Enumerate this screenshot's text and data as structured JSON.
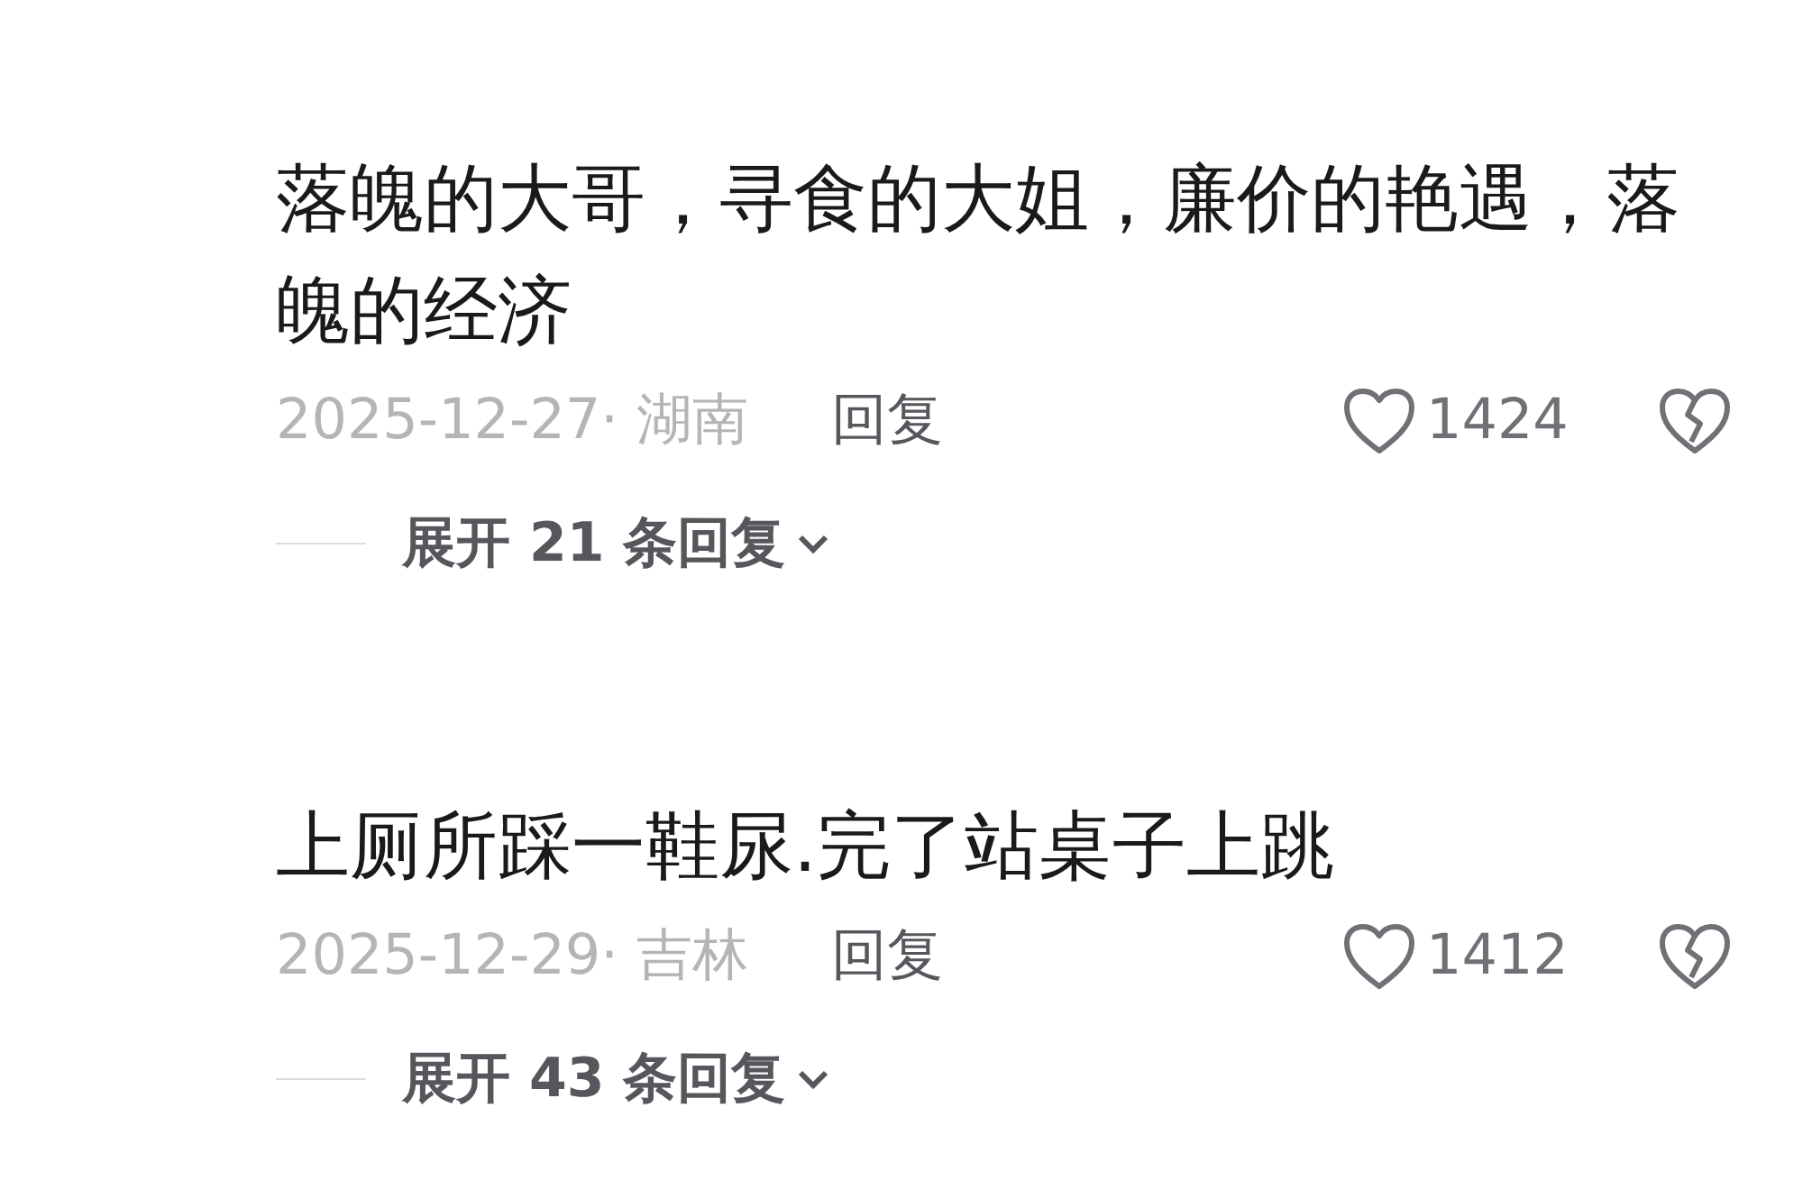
{
  "comments": [
    {
      "text": "落魄的大哥，寻食的大姐，廉价的艳遇，落魄的经济",
      "date": "2025-12-27·",
      "location": "湖南",
      "reply_label": "回复",
      "likes": "1424",
      "expand_label": "展开 21 条回复"
    },
    {
      "text": "上厕所踩一鞋尿.完了站桌子上跳",
      "date": "2025-12-29·",
      "location": "吉林",
      "reply_label": "回复",
      "likes": "1412",
      "expand_label": "展开 43 条回复"
    }
  ]
}
